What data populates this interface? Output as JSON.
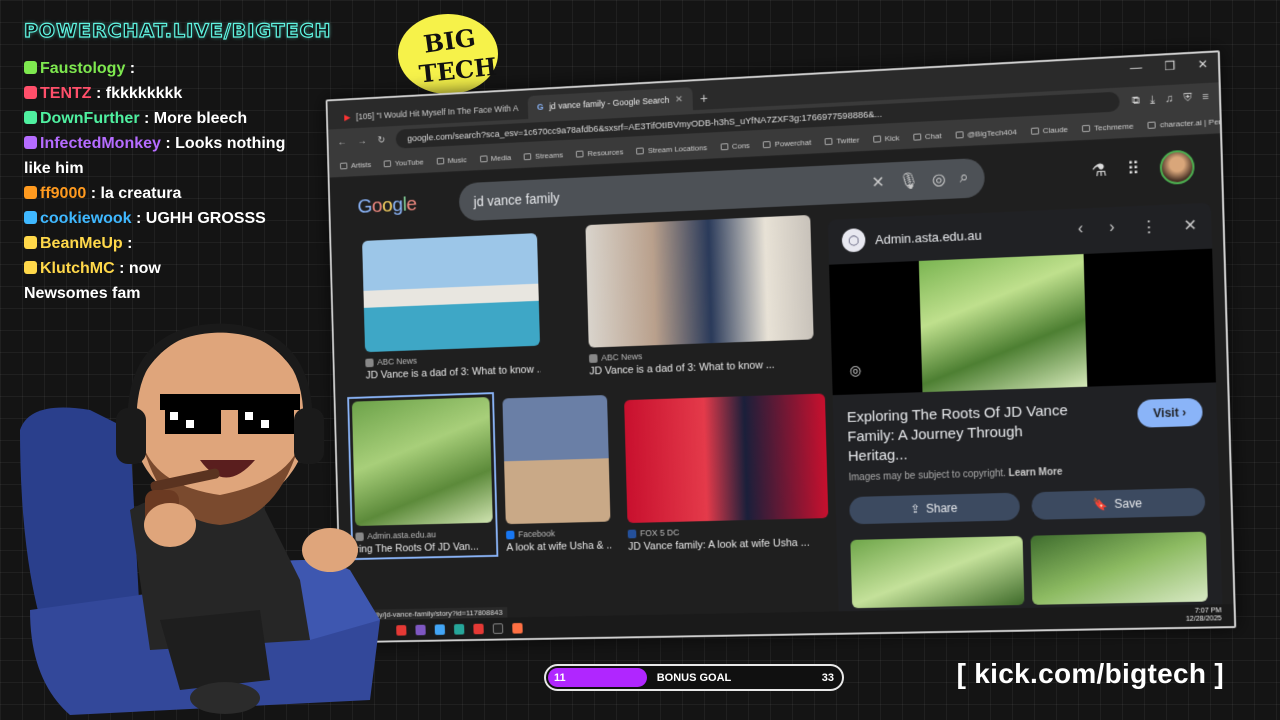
{
  "overlay": {
    "stream_title": "POWERCHAT.LIVE/BIGTECH",
    "logo_text": [
      "BIG",
      "TECH"
    ],
    "kick_url": "[ kick.com/bigtech ]",
    "goal": {
      "current": "11",
      "label": "BONUS GOAL",
      "max": "33",
      "progress": 0.333,
      "fill_color": "#b026ff"
    }
  },
  "chat": [
    {
      "user": "Faustology",
      "sep": " : ",
      "msg": "",
      "color": "#7ee84f"
    },
    {
      "user": "TENTZ",
      "sep": " : ",
      "msg": "fkkkkkkkk",
      "color": "#ff4f6a"
    },
    {
      "user": "DownFurther",
      "sep": " : ",
      "msg": "More bleech",
      "color": "#4ff0a0"
    },
    {
      "user": "InfectedMonkey",
      "sep": " : ",
      "msg": "Looks nothing like him",
      "color": "#b56cff"
    },
    {
      "user": "ff9000",
      "sep": " : ",
      "msg": "la creatura",
      "color": "#ff9a1f"
    },
    {
      "user": "cookiewook",
      "sep": " : ",
      "msg": "UGHH GROSSS",
      "color": "#3fb8ff"
    },
    {
      "user": "BeanMeUp",
      "sep": " : ",
      "msg": "",
      "color": "#ffd84a"
    },
    {
      "user": "KlutchMC",
      "sep": " : ",
      "msg": "now   ",
      "color": "#ffd84a"
    },
    {
      "user": "",
      "sep": "",
      "msg": "Newsomes fam",
      "color": "#ffffff"
    }
  ],
  "browser": {
    "tabs": [
      {
        "label": "[105] \"I Would Hit Myself In The Face With A",
        "active": false
      },
      {
        "label": "jd vance family - Google Search",
        "active": true
      }
    ],
    "url": "google.com/search?sca_esv=1c670cc9a78afdb6&sxsrf=AE3TifOtIBVmyODB-h3hS_uYfNA7ZXF3g:1766977598886&...",
    "bookmarks": [
      "Artists",
      "YouTube",
      "Music",
      "Media",
      "Streams",
      "Resources",
      "Stream Locations",
      "Cons",
      "Powerchat",
      "Twitter",
      "Kick",
      "Chat",
      "@BigTech404",
      "Claude",
      "Techmeme",
      "character.ai | Personalize..."
    ],
    "search_query": "jd vance family",
    "google_logo": [
      "G",
      "o",
      "o",
      "g",
      "l",
      "e"
    ],
    "google_colors": [
      "#8ab4f8",
      "#f28b82",
      "#fdd663",
      "#8ab4f8",
      "#81c995",
      "#f28b82"
    ],
    "results": [
      {
        "source": "ABC News",
        "title": "JD Vance is a dad of 3: What to know ..."
      },
      {
        "source": "ABC News",
        "title": "JD Vance is a dad of 3: What to know ..."
      },
      {
        "source": "Admin.asta.edu.au",
        "title": "ring The Roots Of JD Van..."
      },
      {
        "source": "Facebook",
        "title": "A look at wife Usha & ..."
      },
      {
        "source": "FOX 5 DC",
        "title": "JD Vance family: A look at wife Usha ..."
      }
    ],
    "panel": {
      "site": "Admin.asta.edu.au",
      "title": "Exploring The Roots Of JD Vance Family: A Journey Through Heritag...",
      "visit": "Visit",
      "copyright": "Images may be subject to copyright.",
      "learn_more": "Learn More",
      "share": "Share",
      "save": "Save"
    },
    "status_url": "344/family/jd-vance-family/story?id=117808843",
    "clock": {
      "time": "7:07 PM",
      "date": "12/28/2025"
    }
  }
}
